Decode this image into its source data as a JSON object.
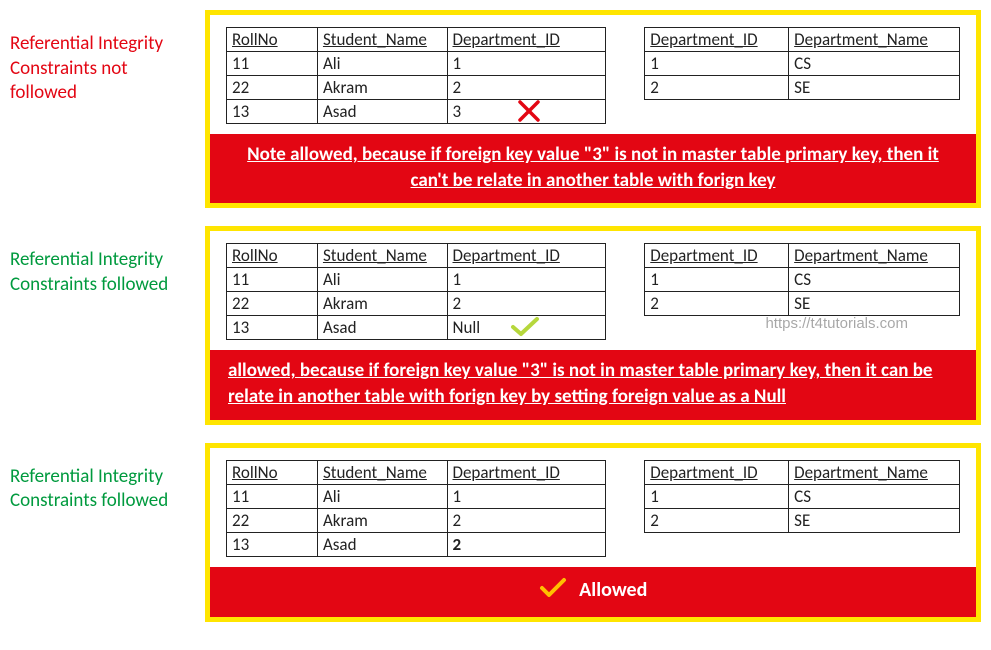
{
  "watermark": "https://t4tutorials.com",
  "sections": [
    {
      "label_text": "Referential Integrity Constraints not followed",
      "label_color": "red",
      "student_headers": [
        "RollNo",
        "Student_Name",
        "Department_ID"
      ],
      "student_rows": [
        [
          "11",
          "Ali",
          "1"
        ],
        [
          "22",
          "Akram",
          "2"
        ],
        [
          "13",
          "Asad",
          "3"
        ]
      ],
      "dept_headers": [
        "Department_ID",
        "Department_Name"
      ],
      "dept_rows": [
        [
          "1",
          "CS"
        ],
        [
          "2",
          "SE"
        ]
      ],
      "note": "Note allowed, because if foreign key value \"3\" is not in master table primary key, then it can't be relate in another table with forign key",
      "icon": "cross"
    },
    {
      "label_text": "Referential Integrity Constraints followed",
      "label_color": "green",
      "student_headers": [
        "RollNo",
        "Student_Name",
        "Department_ID"
      ],
      "student_rows": [
        [
          "11",
          "Ali",
          "1"
        ],
        [
          "22",
          "Akram",
          "2"
        ],
        [
          "13",
          "Asad",
          "Null"
        ]
      ],
      "dept_headers": [
        "Department_ID",
        "Department_Name"
      ],
      "dept_rows": [
        [
          "1",
          "CS"
        ],
        [
          "2",
          "SE"
        ]
      ],
      "note": "allowed, because if foreign key value \"3\" is not in master table primary key, then it can be relate in another table with forign key by setting foreign value as a Null",
      "icon": "check"
    },
    {
      "label_text": "Referential Integrity Constraints followed",
      "label_color": "green",
      "student_headers": [
        "RollNo",
        "Student_Name",
        "Department_ID"
      ],
      "student_rows": [
        [
          "11",
          "Ali",
          "1"
        ],
        [
          "22",
          "Akram",
          "2"
        ],
        [
          "13",
          "Asad",
          "2"
        ]
      ],
      "dept_headers": [
        "Department_ID",
        "Department_Name"
      ],
      "dept_rows": [
        [
          "1",
          "CS"
        ],
        [
          "2",
          "SE"
        ]
      ],
      "allowed_label": "Allowed"
    }
  ]
}
